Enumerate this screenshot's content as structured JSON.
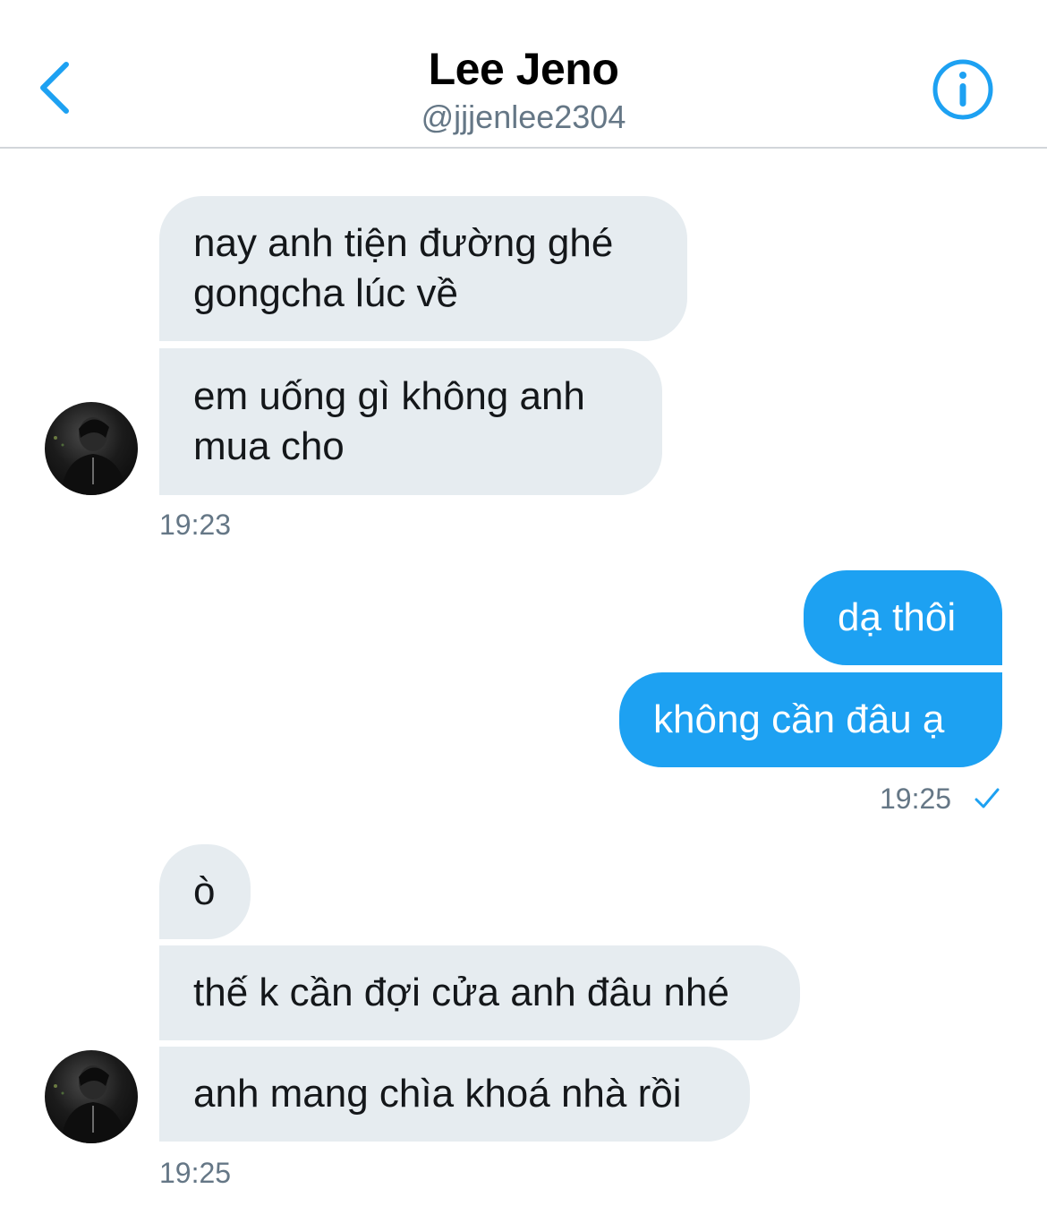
{
  "header": {
    "name": "Lee Jeno",
    "handle": "@jjjenlee2304",
    "back_icon": "chevron-left-icon",
    "info_icon": "info-circle-icon",
    "accent": "#1da1f2"
  },
  "messages": {
    "group1": {
      "m1": "nay anh tiện đường ghé gongcha lúc về",
      "m2": "em uống gì không anh mua cho",
      "time": "19:23"
    },
    "group2": {
      "m1": "dạ thôi",
      "m2": "không cần đâu ạ",
      "time": "19:25",
      "status_icon": "read-check-icon"
    },
    "group3": {
      "m1": "ò",
      "m2": "thế k cần đợi cửa anh đâu nhé",
      "m3": "anh mang chìa khoá nhà rồi",
      "time": "19:25"
    }
  },
  "colors": {
    "received_bubble": "#e6ecf0",
    "sent_bubble": "#1da1f2",
    "timestamp": "#657786"
  }
}
